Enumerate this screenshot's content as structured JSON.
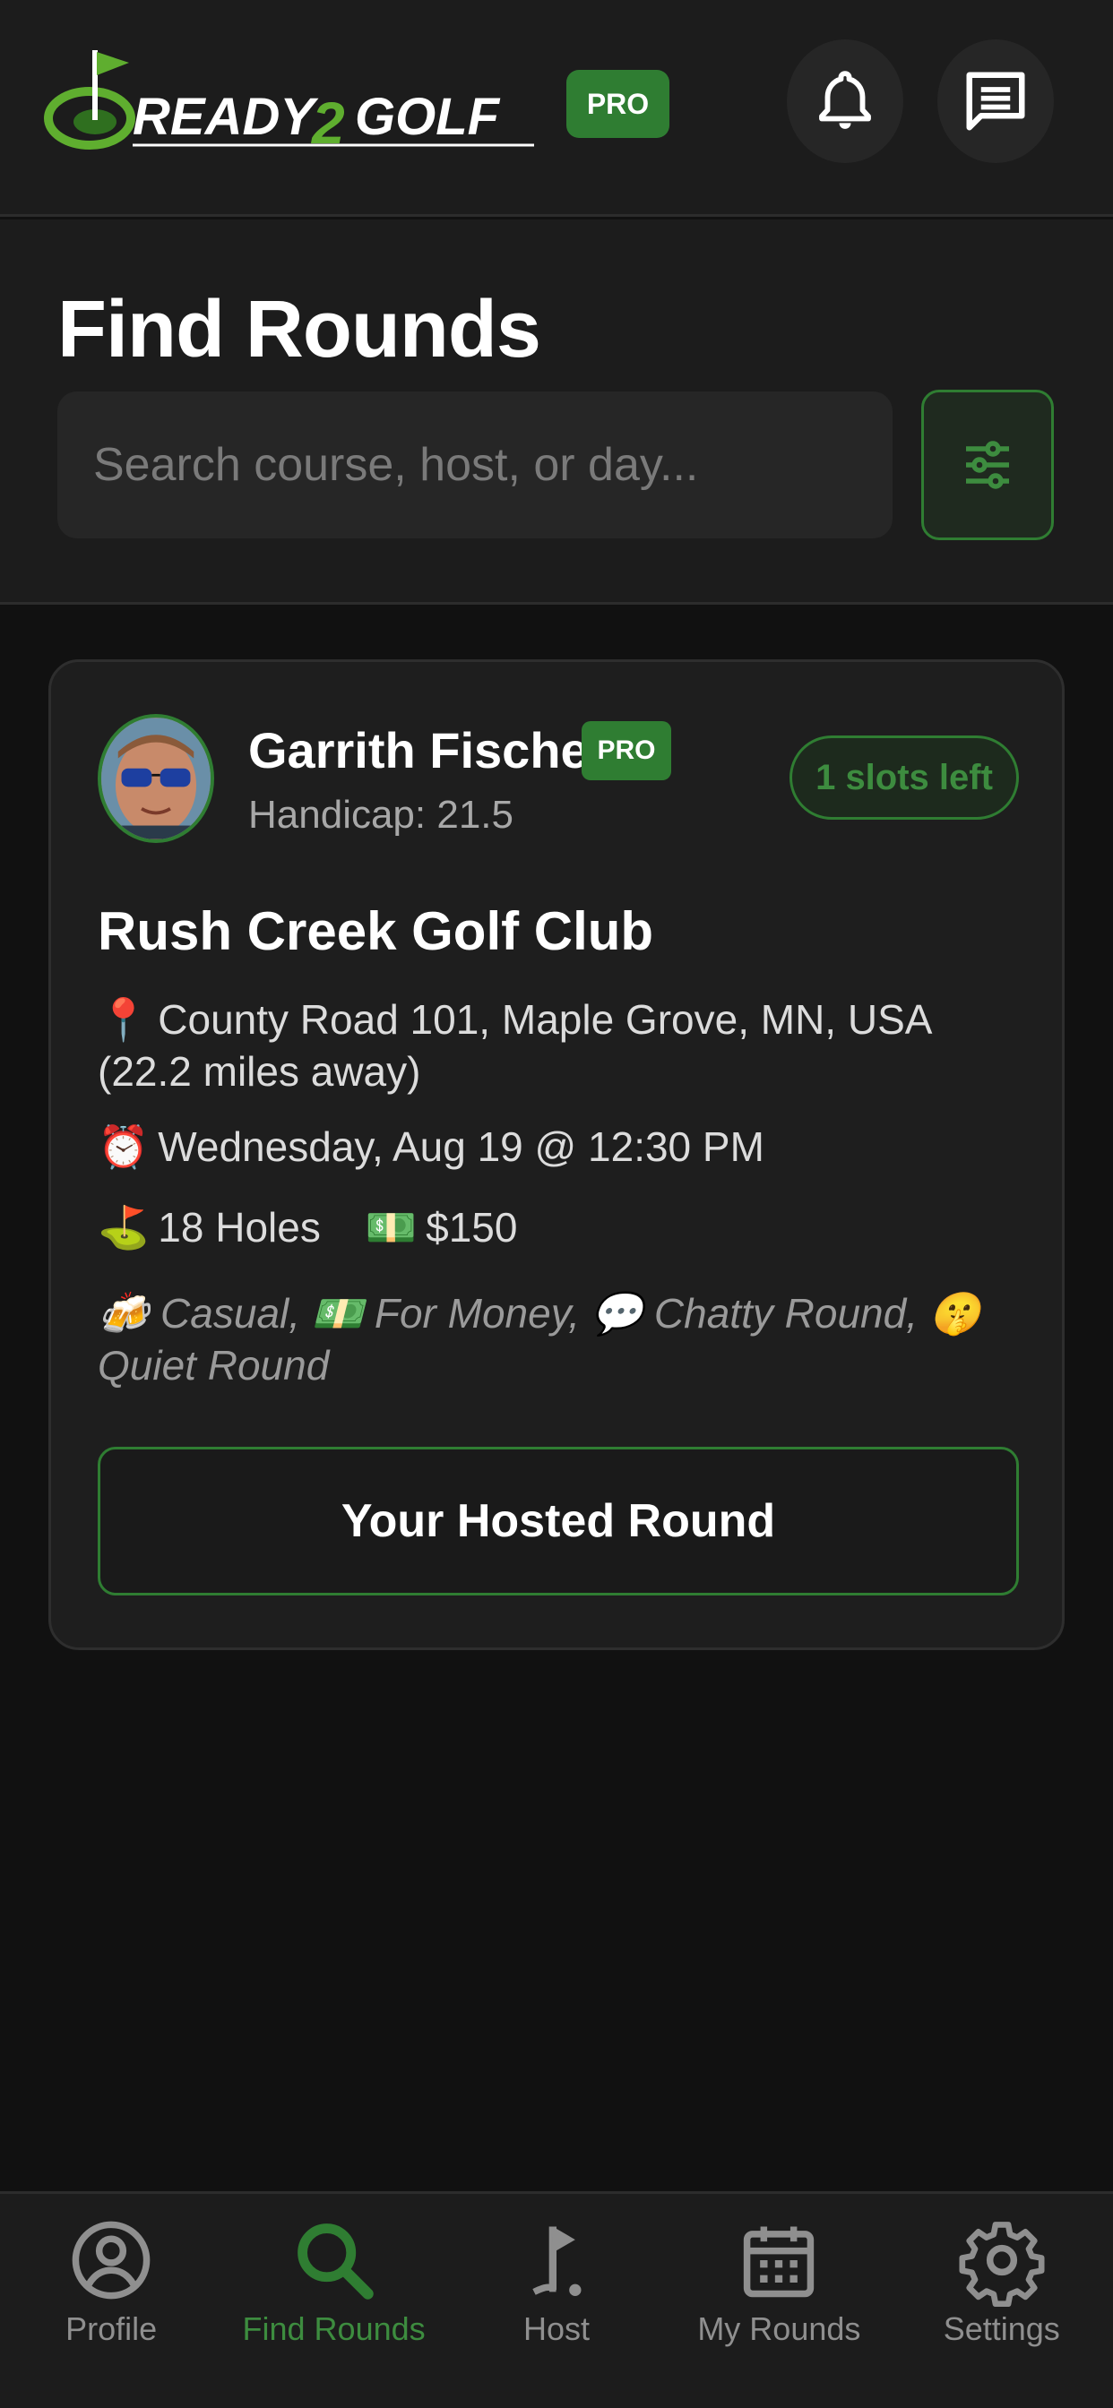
{
  "header": {
    "logo_text": "READY2GOLF",
    "pro_badge": "PRO",
    "bell_icon": "bell-icon",
    "chat_icon": "chat-icon"
  },
  "find_rounds": {
    "title": "Find Rounds",
    "search_placeholder": "Search course, host, or day...",
    "search_value": "",
    "filter_icon": "sliders-icon"
  },
  "round_card": {
    "host_name": "Garrith Fischer",
    "host_badge": "PRO",
    "handicap": "Handicap: 21.5",
    "slots": "1 slots left",
    "course": "Rush Creek Golf Club",
    "location_emoji": "📍",
    "location": "County Road 101, Maple Grove, MN, USA (22.2 miles away)",
    "time_emoji": "⏰",
    "datetime": "Wednesday, Aug 19 @ 12:30 PM",
    "holes_emoji": "⛳",
    "holes": "18 Holes",
    "price_emoji": "💵",
    "price": "$150",
    "tags": "🍻 Casual, 💵 For Money, 💬 Chatty Round, 🤫 Quiet Round",
    "action_label": "Your Hosted Round"
  },
  "bottom_nav": {
    "items": [
      {
        "label": "Profile",
        "icon": "profile-icon"
      },
      {
        "label": "Find Rounds",
        "icon": "search-icon"
      },
      {
        "label": "Host",
        "icon": "golf-flag-icon"
      },
      {
        "label": "My Rounds",
        "icon": "calendar-icon"
      },
      {
        "label": "Settings",
        "icon": "gear-icon"
      }
    ],
    "active_index": 1
  },
  "colors": {
    "accent_green": "#2f7d32",
    "accent_green_text": "#3d8c3f",
    "background": "#111111",
    "surface": "#1c1c1c",
    "card": "#1e1e1e"
  }
}
